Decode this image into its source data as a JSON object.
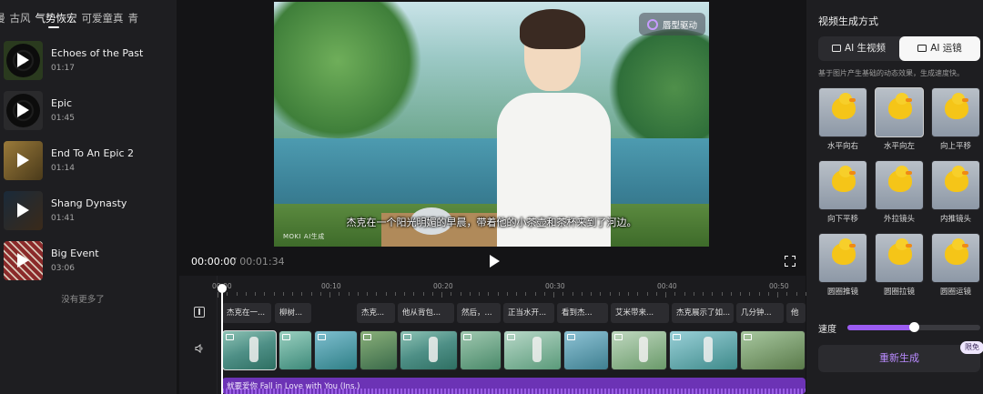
{
  "music": {
    "tabs": [
      {
        "label": "漫",
        "active": false
      },
      {
        "label": "古风",
        "active": false
      },
      {
        "label": "气势恢宏",
        "active": true
      },
      {
        "label": "可爱童真",
        "active": false
      },
      {
        "label": "青",
        "active": false
      }
    ],
    "tracks": [
      {
        "title": "Echoes of the Past",
        "duration": "01:17",
        "cover_color": "#2a3a1e"
      },
      {
        "title": "Epic",
        "duration": "01:45",
        "cover_color": "#2a2a2c"
      },
      {
        "title": "End To An Epic 2",
        "duration": "01:14",
        "cover_color": "#7a5a2a"
      },
      {
        "title": "Shang Dynasty",
        "duration": "01:41",
        "cover_color": "#1e2e3a"
      },
      {
        "title": "Big Event",
        "duration": "03:06",
        "cover_color": "#7a2a2a"
      }
    ],
    "no_more": "没有更多了"
  },
  "preview": {
    "tag": "唇型驱动",
    "subtitle": "杰克在一个阳光明媚的早晨，带着他的小茶壶和茶杯来到了河边。",
    "watermark": "MOKI AI生成",
    "time_current": "00:00:00",
    "time_total": "/ 00:01:34"
  },
  "timeline": {
    "ruler": [
      "00:00",
      "00:10",
      "00:20",
      "00:30",
      "00:40",
      "00:50"
    ],
    "captions": [
      "杰克在一...",
      "柳树...",
      "杰克...",
      "他从背包...",
      "然后，...",
      "正当水开...",
      "看到杰...",
      "艾米带来...",
      "杰克展示了如...",
      "几分钟...",
      "他"
    ],
    "audio_label": "就要爱你 Fall in Love with You (Ins.)"
  },
  "right": {
    "title": "视频生成方式",
    "modes": [
      {
        "label": "AI 生视频",
        "active": false
      },
      {
        "label": "AI 运镜",
        "active": true
      }
    ],
    "description": "基于图片产生基础的动态效果，生成速度快。",
    "effects": [
      {
        "label": "水平向右",
        "selected": false
      },
      {
        "label": "水平向左",
        "selected": true
      },
      {
        "label": "向上平移",
        "selected": false
      },
      {
        "label": "向下平移",
        "selected": false
      },
      {
        "label": "外拉镜头",
        "selected": false
      },
      {
        "label": "内推镜头",
        "selected": false
      },
      {
        "label": "圆圈推镜",
        "selected": false
      },
      {
        "label": "圆圈拉镜",
        "selected": false
      },
      {
        "label": "圆圈运镜",
        "selected": false
      }
    ],
    "speed_label": "速度",
    "speed_value": 0.5,
    "regenerate": "重新生成",
    "free_badge": "限免",
    "accent": "#9b5cf2"
  }
}
